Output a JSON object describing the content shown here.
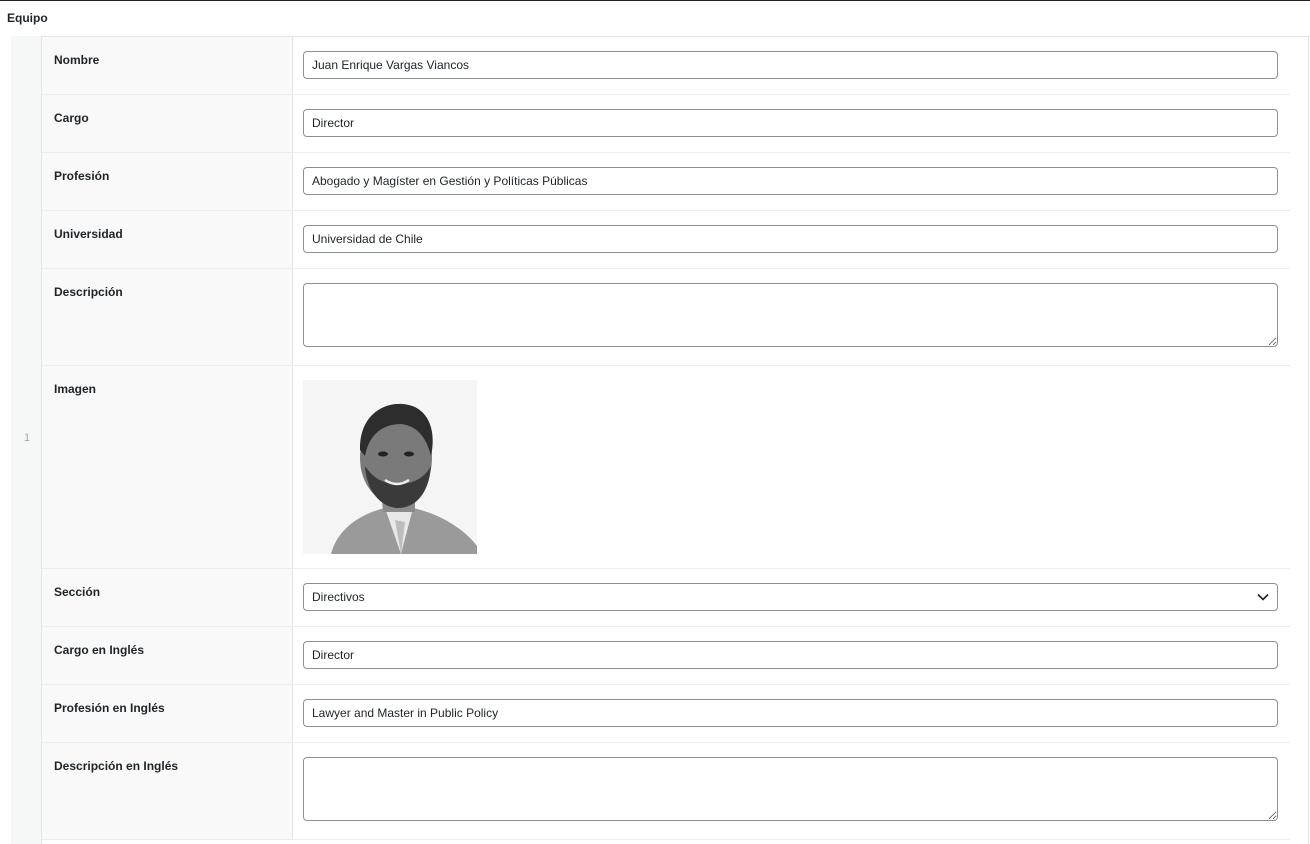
{
  "section": {
    "title": "Equipo"
  },
  "row": {
    "number": "1"
  },
  "fields": {
    "nombre": {
      "label": "Nombre",
      "value": "Juan Enrique Vargas Viancos"
    },
    "cargo": {
      "label": "Cargo",
      "value": "Director"
    },
    "profesion": {
      "label": "Profesión",
      "value": "Abogado y Magíster en Gestión y Políticas Públicas"
    },
    "universidad": {
      "label": "Universidad",
      "value": "Universidad de Chile"
    },
    "descripcion": {
      "label": "Descripción",
      "value": ""
    },
    "imagen": {
      "label": "Imagen"
    },
    "seccion": {
      "label": "Sección",
      "value": "Directivos"
    },
    "cargo_en": {
      "label": "Cargo en Inglés",
      "value": "Director"
    },
    "profesion_en": {
      "label": "Profesión en Inglés",
      "value": "Lawyer and Master in Public Policy"
    },
    "descripcion_en": {
      "label": "Descripción en Inglés",
      "value": ""
    }
  },
  "icons": {
    "select_arrow": "chevron-down-icon"
  }
}
